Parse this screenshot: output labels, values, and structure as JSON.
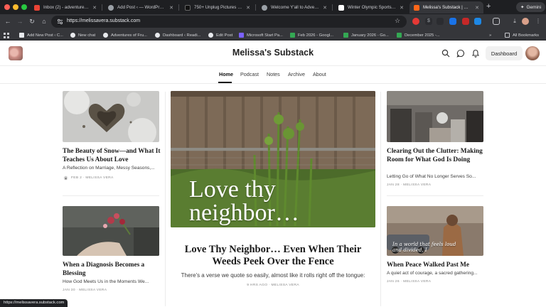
{
  "browser": {
    "tabs": [
      {
        "label": "Inbox (2) - adventuresfrugal",
        "favicon_color": "#ea4335"
      },
      {
        "label": "Add Post ‹ — WordPress",
        "favicon_color": "#9aa0a6"
      },
      {
        "label": "750+ Unplug Pictures | Do",
        "favicon_color": "#111111"
      },
      {
        "label": "Welcome Y'all to Adventur",
        "favicon_color": "#9aa0a6"
      },
      {
        "label": "Winter Olympic Sports List",
        "favicon_color": "#ffffff"
      },
      {
        "label": "Melissa's Substack | Meliss",
        "favicon_color": "#ff6719"
      }
    ],
    "new_tab_glyph": "+",
    "gemini_label": "Gemini",
    "url": "https://melissavera.substack.com",
    "bookmarks": [
      {
        "label": "Add New Post ‹ C...",
        "color": "#e8eaed"
      },
      {
        "label": "New chat",
        "color": "#e8eaed"
      },
      {
        "label": "Adventures of Fru...",
        "color": "#e8eaed"
      },
      {
        "label": "Dashboard ‹ Readi...",
        "color": "#e8eaed"
      },
      {
        "label": "Edit Post",
        "color": "#e8eaed"
      },
      {
        "label": "Microsoft Start Pa...",
        "color": "#7b61ff"
      },
      {
        "label": "Feb 2026 - Googl...",
        "color": "#34a853"
      },
      {
        "label": "January 2026 - Go...",
        "color": "#34a853"
      },
      {
        "label": "December 2025 -...",
        "color": "#34a853"
      }
    ],
    "all_bookmarks_label": "All Bookmarks",
    "status_url": "https://melissavera.substack.com"
  },
  "site": {
    "title": "Melissa's Substack",
    "dashboard_label": "Dashboard",
    "nav": [
      {
        "label": "Home",
        "active": true
      },
      {
        "label": "Podcast",
        "active": false
      },
      {
        "label": "Notes",
        "active": false
      },
      {
        "label": "Archive",
        "active": false
      },
      {
        "label": "About",
        "active": false
      }
    ]
  },
  "posts": {
    "left_top": {
      "title": "The Beauty of Snow—and What It Teaches Us About Love",
      "subtitle": "A Reflection on Marriage, Messy Seasons,...",
      "meta": "FEB 2 · MELISSA VERA",
      "locked": true
    },
    "left_bottom": {
      "title": "When a Diagnosis Becomes a Blessing",
      "subtitle": "How God Meets Us in the Moments We...",
      "meta": "JAN 30 · MELISSA VERA"
    },
    "featured": {
      "image_text": "Love thy neighbor…",
      "title": "Love Thy Neighbor… Even When Their Weeds Peek Over the Fence",
      "subtitle": "There's a verse we quote so easily, almost like it rolls right off the tongue:",
      "meta": "9 HRS AGO · MELISSA VERA"
    },
    "right_top": {
      "title": "Clearing Out the Clutter: Making Room for What God Is Doing",
      "subtitle": "Letting Go of What No Longer Serves So...",
      "meta": "JAN 28 · MELISSA VERA"
    },
    "right_bottom": {
      "image_text": "In a world that feels loud and divided, I",
      "title": "When Peace Walked Past Me",
      "subtitle": "A quiet act of courage, a sacred gathering...",
      "meta": "JAN 26 · MELISSA VERA"
    }
  }
}
